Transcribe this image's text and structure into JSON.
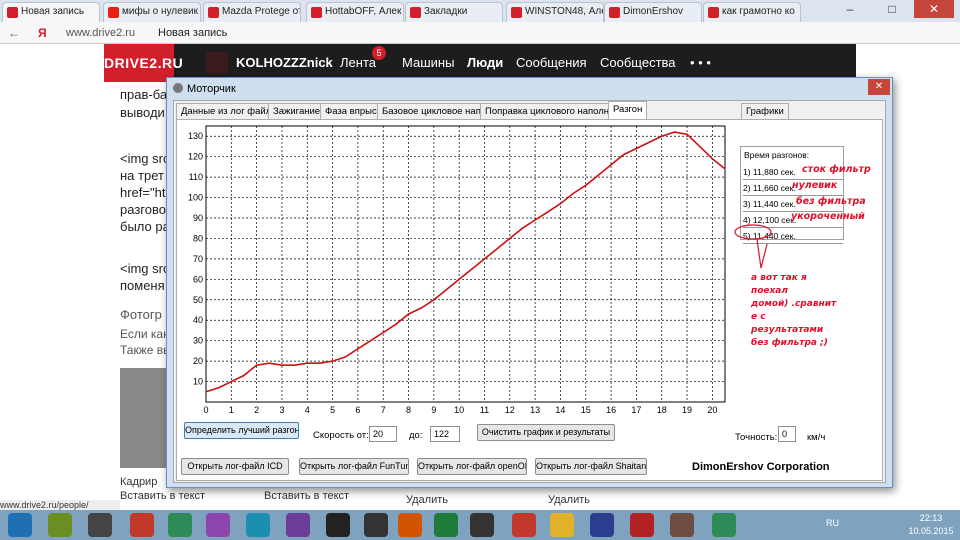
{
  "browser": {
    "tabs": [
      {
        "label": "Новая запись",
        "color": "#d11f2c"
      },
      {
        "label": "мифы о нулевик",
        "color": "#e62117"
      },
      {
        "label": "Mazda Protege от",
        "color": "#d11f2c"
      },
      {
        "label": "HottabOFF, Алек",
        "color": "#d11f2c"
      },
      {
        "label": "Закладки",
        "color": "#d11f2c"
      },
      {
        "label": "WINSTON48, Алек",
        "color": "#d11f2c"
      },
      {
        "label": "DimonErshov",
        "color": "#d11f2c"
      },
      {
        "label": "как грамотно ко",
        "color": "#d11f2c"
      }
    ],
    "url": "www.drive2.ru",
    "page_title": "Новая запись",
    "status_url": "www.drive2.ru/people/"
  },
  "site": {
    "logo": "DRIVE2.RU",
    "username": "KOLHOZZZnick",
    "nav": [
      "Лента",
      "Машины",
      "Люди",
      "Сообщения",
      "Сообщества",
      "• • •"
    ],
    "feed_badge": "5",
    "body_lines": [
      "прав-ба",
      "выводи",
      "<img src",
      "на трет",
      "href=\"ht",
      "разгово",
      "было ра",
      "<img src",
      "поменя",
      "Фотогр",
      "Если как",
      "Также вы"
    ],
    "photo_actions": [
      "Кадрир",
      "Вставить в текст",
      "Вставить в текст",
      "Удалить",
      "Удалить"
    ]
  },
  "app": {
    "title": "Моторчик",
    "tabs": [
      "Данные из лог файла",
      "Зажигание",
      "Фаза впрыска",
      "Базовое цикловое наполнение",
      "Поправка циклового наполнения",
      "Разгон",
      "Графики"
    ],
    "results_header": "Время разгонов:",
    "results": [
      "1) 11,880 сек.",
      "2) 11,660 сек.",
      "3) 11,440 сек.",
      "4) 12,100 сек.",
      "5) 11,440 сек."
    ],
    "annotations": [
      "сток фильтр",
      "нулевик",
      "без фильтра",
      "укороченный"
    ],
    "note_lines": [
      "а вот так я",
      "поехал",
      "домой) .сравнит",
      "е с",
      "результатами",
      "без фильтра ;)"
    ],
    "best_button": "Определить лучший разгон",
    "speed_from_label": "Скорость от:",
    "speed_from": "20",
    "speed_to_label": "до:",
    "speed_to": "122",
    "clear_button": "Очистить график и результаты",
    "accuracy_label": "Точность:",
    "accuracy": "0",
    "accuracy_unit": "км/ч",
    "open_buttons": [
      "Открыть лог-файл ICD",
      "Открыть лог-файл FunTune",
      "Открыть лог-файл openOLT",
      "Открыть лог-файл Shaitane"
    ],
    "corporation": "DimonErshov Corporation"
  },
  "taskbar": {
    "lang": "RU",
    "time": "22:13",
    "date": "10.05.2015"
  },
  "chart_data": {
    "type": "line",
    "title": "",
    "xlabel": "",
    "ylabel": "",
    "xlim": [
      0,
      20.5
    ],
    "ylim": [
      0,
      135
    ],
    "xticks": [
      0,
      1,
      2,
      3,
      4,
      5,
      6,
      7,
      8,
      9,
      10,
      11,
      12,
      13,
      14,
      15,
      16,
      17,
      18,
      19,
      20
    ],
    "yticks": [
      10,
      20,
      30,
      40,
      50,
      60,
      70,
      80,
      90,
      100,
      110,
      120,
      130
    ],
    "grid": true,
    "color": "#cc1111",
    "x": [
      0,
      0.5,
      1,
      1.5,
      2,
      2.5,
      3,
      3.5,
      4,
      4.5,
      5,
      5.5,
      6,
      6.5,
      7,
      7.5,
      8,
      8.5,
      9,
      9.5,
      10,
      10.5,
      11,
      11.5,
      12,
      12.5,
      13,
      13.5,
      14,
      14.5,
      15,
      15.5,
      16,
      16.5,
      17,
      17.5,
      18,
      18.5,
      19,
      19.5,
      20,
      20.5
    ],
    "y": [
      5,
      7,
      10,
      13,
      18,
      19,
      18,
      18,
      19,
      19,
      20,
      22,
      26,
      30,
      34,
      38,
      43,
      46,
      50,
      55,
      60,
      65,
      70,
      75,
      80,
      85,
      89,
      93,
      97,
      102,
      106,
      111,
      116,
      121,
      124,
      127,
      130,
      132,
      131,
      125,
      119,
      114
    ]
  }
}
